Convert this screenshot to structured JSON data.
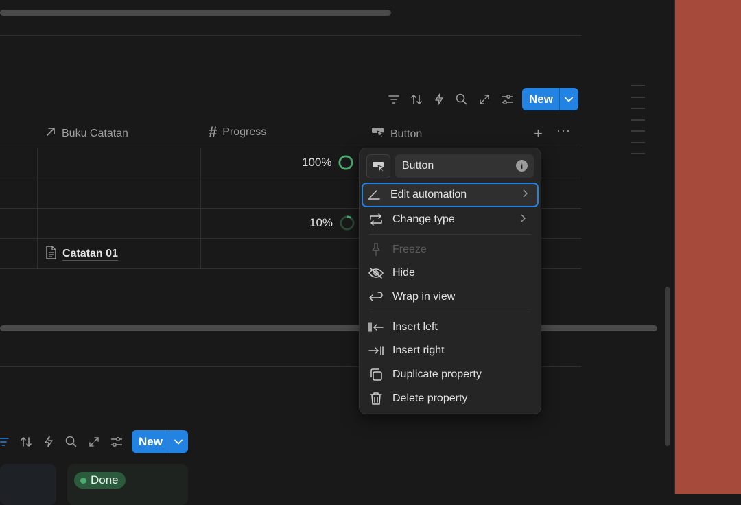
{
  "toolbar_top": {
    "new_label": "New",
    "icons": [
      "filter-icon",
      "sort-icon",
      "lightning-icon",
      "search-icon",
      "expand-icon",
      "settings-sliders-icon"
    ]
  },
  "columns": {
    "buku_catatan": "Buku Catatan",
    "progress": "Progress",
    "button": "Button"
  },
  "rows": [
    {
      "progress": "100%",
      "progress_value": 1.0
    },
    {
      "progress": "",
      "progress_value": 0
    },
    {
      "progress": "10%",
      "progress_value": 0.1
    },
    {
      "buku_catatan": "Catatan 01"
    }
  ],
  "menu": {
    "name_value": "Button",
    "items": [
      {
        "label": "Edit automation",
        "icon": "pencil-icon",
        "submenu": true
      },
      {
        "label": "Change type",
        "icon": "change-type-icon",
        "submenu": true
      },
      {
        "label": "Freeze",
        "icon": "pin-icon",
        "disabled": true
      },
      {
        "label": "Hide",
        "icon": "eye-off-icon"
      },
      {
        "label": "Wrap in view",
        "icon": "wrap-icon"
      },
      {
        "label": "Insert left",
        "icon": "insert-left-icon"
      },
      {
        "label": "Insert right",
        "icon": "insert-right-icon"
      },
      {
        "label": "Duplicate property",
        "icon": "duplicate-icon"
      },
      {
        "label": "Delete property",
        "icon": "trash-icon"
      }
    ]
  },
  "toolbar_bottom": {
    "new_label": "New"
  },
  "board": {
    "status_label": "Done"
  },
  "colors": {
    "accent": "#2383e2",
    "done_green": "#4dab6f",
    "bg": "#191919",
    "side_panel": "#a64a3c"
  }
}
